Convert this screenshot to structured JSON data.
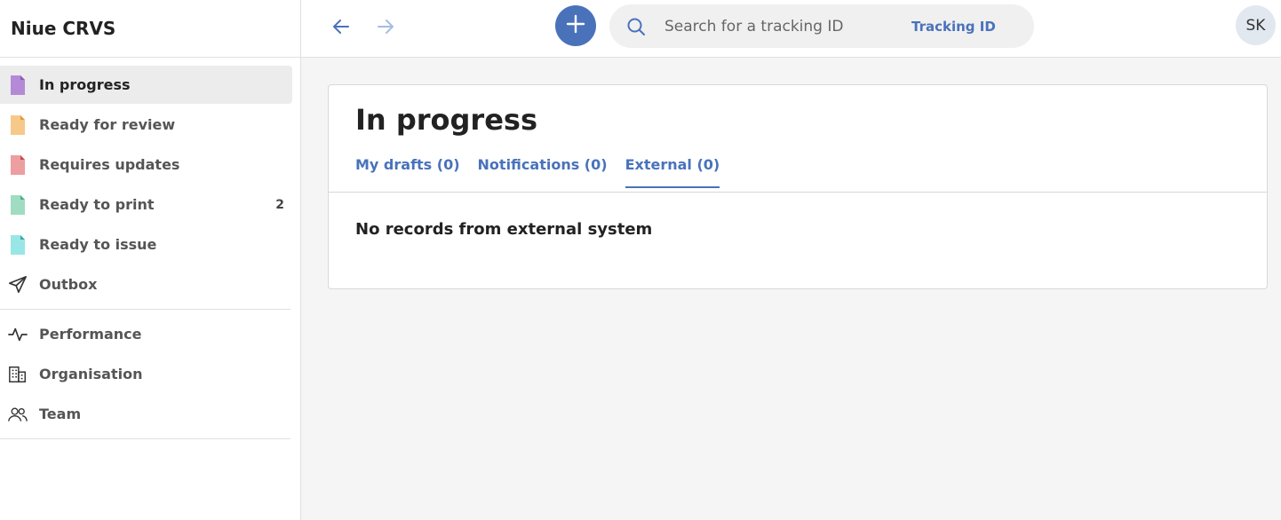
{
  "app": {
    "title": "Niue CRVS"
  },
  "sidebar": {
    "items": [
      {
        "label": "In progress",
        "icon": "document-purple-icon",
        "color": "#b48ad6",
        "count": ""
      },
      {
        "label": "Ready for review",
        "icon": "document-orange-icon",
        "color": "#f6c98a",
        "count": ""
      },
      {
        "label": "Requires updates",
        "icon": "document-red-icon",
        "color": "#ec9ea0",
        "count": ""
      },
      {
        "label": "Ready to print",
        "icon": "document-green-icon",
        "color": "#9fdcc2",
        "count": "2"
      },
      {
        "label": "Ready to issue",
        "icon": "document-cyan-icon",
        "color": "#99e6e6",
        "count": ""
      },
      {
        "label": "Outbox",
        "icon": "send-icon",
        "count": ""
      }
    ],
    "secondary": [
      {
        "label": "Performance",
        "icon": "activity-icon"
      },
      {
        "label": "Organisation",
        "icon": "building-icon"
      },
      {
        "label": "Team",
        "icon": "users-icon"
      }
    ]
  },
  "topbar": {
    "search_placeholder": "Search for a tracking ID",
    "search_type": "Tracking ID",
    "avatar_initials": "SK"
  },
  "main": {
    "title": "In progress",
    "tabs": [
      {
        "label": "My drafts (0)",
        "active": false
      },
      {
        "label": "Notifications (0)",
        "active": false
      },
      {
        "label": "External (0)",
        "active": true
      }
    ],
    "empty_message": "No records from external system"
  },
  "colors": {
    "accent": "#4972bb",
    "fab": "#4972bb",
    "active_bg": "#ececec"
  }
}
